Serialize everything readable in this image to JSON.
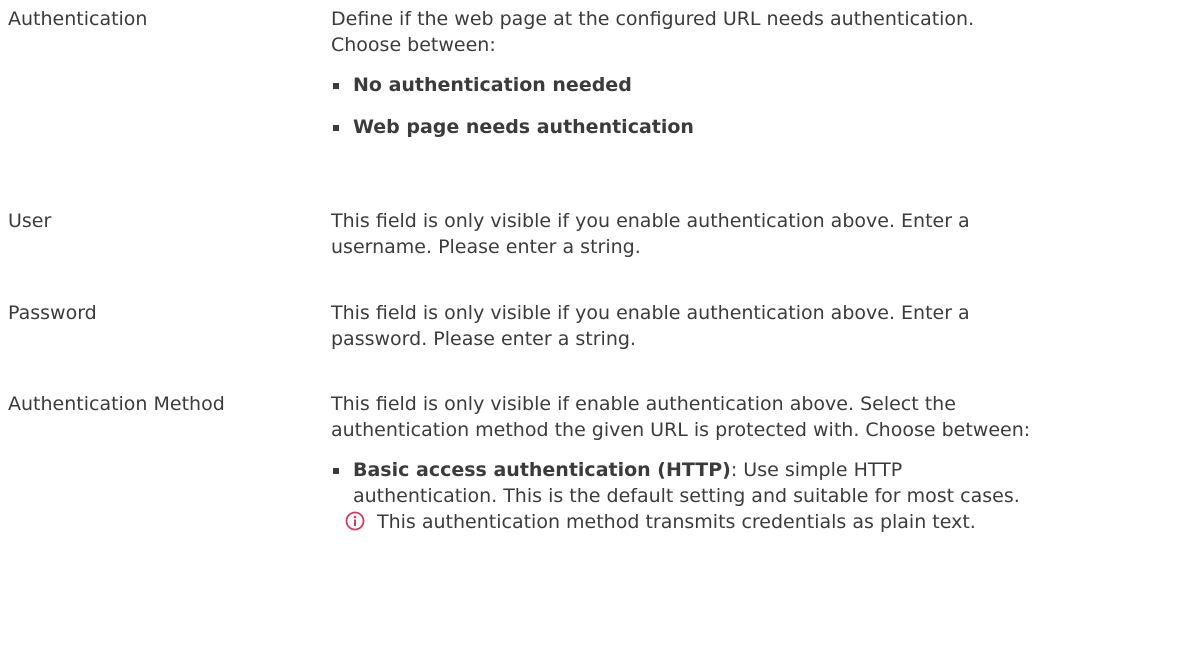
{
  "rows": [
    {
      "label": "Authentication",
      "text": "Define if the web page at the configured URL needs authentication. Choose between:",
      "options": [
        {
          "name": "No authentication needed"
        },
        {
          "name": "Web page needs authentication"
        }
      ]
    },
    {
      "label": "User",
      "text": "This field is only visible if you enable authentication above. Enter a username. Please enter a string."
    },
    {
      "label": "Password",
      "text": "This field is only visible if you enable authentication above. Enter a password. Please enter a string."
    },
    {
      "label": "Authentication Method",
      "text": "This field is only visible if enable authentication above. Select the authentication method the given URL is protected with. Choose between:",
      "options": [
        {
          "name": "Basic access authentication (HTTP)",
          "desc": ": Use simple HTTP authentication. This is the default setting and suitable for most cases.",
          "note": "This authentication method transmits credentials as plain text."
        }
      ]
    }
  ],
  "icons": {
    "note_icon": "info-circle-icon",
    "note_color": "#d9365e"
  }
}
